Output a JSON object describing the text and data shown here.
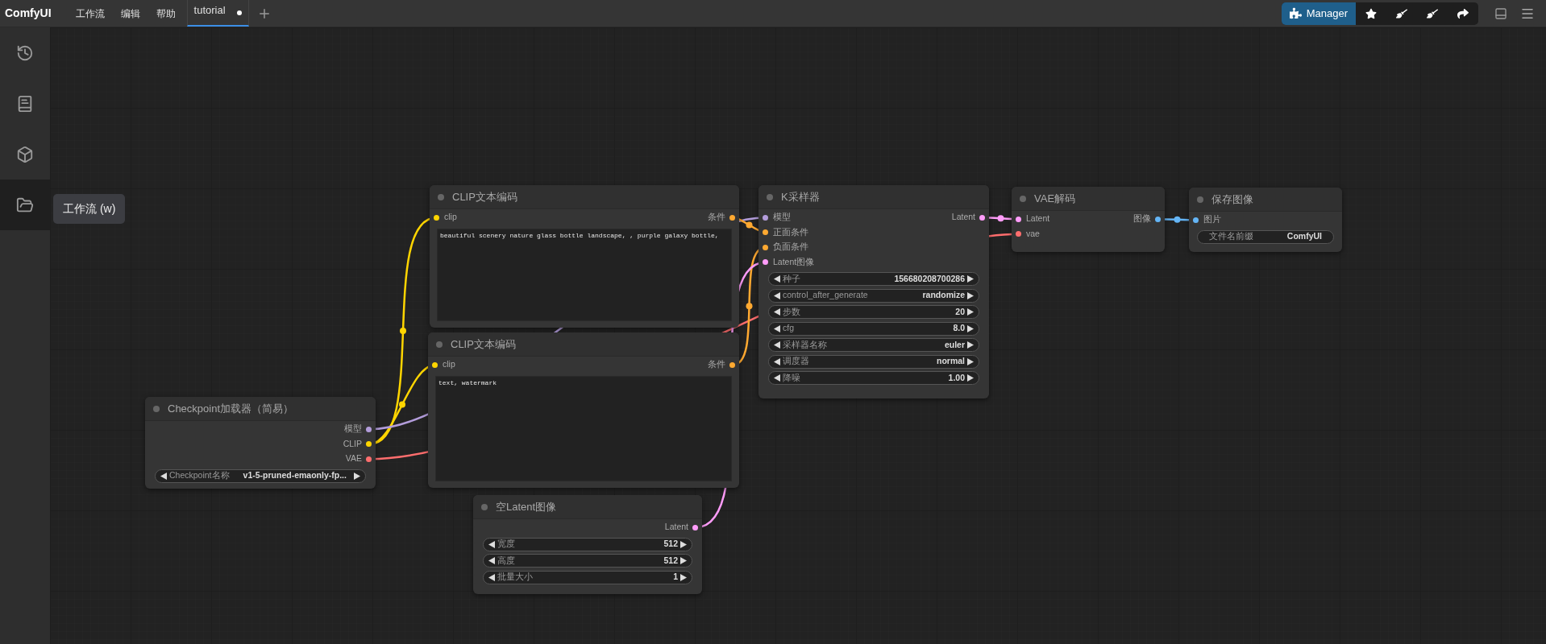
{
  "menu_bar": {
    "logo": "ComfyUI",
    "menus": [
      "工作流",
      "编辑",
      "帮助"
    ],
    "tabs": [
      {
        "label": "tutorial",
        "selected": true,
        "unsaved": true
      }
    ],
    "manager_button": "Manager"
  },
  "sidebar": {
    "items": [
      {
        "kind": "history",
        "selected": false
      },
      {
        "kind": "library",
        "selected": false
      },
      {
        "kind": "models",
        "selected": false
      },
      {
        "kind": "workflows",
        "selected": true
      }
    ],
    "tooltip": "工作流 (w)"
  },
  "nodes": [
    {
      "title": "CLIP文本编码",
      "inputs": [
        {
          "label": "clip",
          "color": "#ffd500"
        }
      ],
      "outputs": [
        {
          "label": "条件",
          "color": "#ffa931"
        }
      ],
      "widgets": [
        {
          "kind": "text",
          "value": "beautiful scenery nature glass bottle landscape, , purple galaxy bottle,"
        }
      ]
    },
    {
      "title": "K采样器",
      "inputs": [
        {
          "label": "模型",
          "color": "#b39ddb"
        },
        {
          "label": "正面条件",
          "color": "#ffa931"
        },
        {
          "label": "负面条件",
          "color": "#ffa931"
        },
        {
          "label": "Latent图像",
          "color": "#ff9cf9"
        }
      ],
      "outputs": [
        {
          "label": "Latent",
          "color": "#ff9cf9"
        }
      ],
      "widgets": [
        {
          "kind": "number",
          "label": "种子",
          "value": "156680208700286"
        },
        {
          "kind": "combo",
          "label": "control_after_generate",
          "value": "randomize"
        },
        {
          "kind": "number",
          "label": "步数",
          "value": "20"
        },
        {
          "kind": "number",
          "label": "cfg",
          "value": "8.0"
        },
        {
          "kind": "combo",
          "label": "采样器名称",
          "value": "euler"
        },
        {
          "kind": "combo",
          "label": "调度器",
          "value": "normal"
        },
        {
          "kind": "number",
          "label": "降噪",
          "value": "1.00"
        }
      ]
    },
    {
      "title": "VAE解码",
      "inputs": [
        {
          "label": "Latent",
          "color": "#ff9cf9"
        },
        {
          "label": "vae",
          "color": "#ff6e6e"
        }
      ],
      "outputs": [
        {
          "label": "图像",
          "color": "#64b5f6"
        }
      ]
    },
    {
      "title": "保存图像",
      "inputs": [
        {
          "label": "图片",
          "color": "#64b5f6"
        }
      ],
      "widgets": [
        {
          "kind": "string",
          "label": "文件名前缀",
          "value": "ComfyUI"
        }
      ]
    },
    {
      "title": "CLIP文本编码",
      "inputs": [
        {
          "label": "clip",
          "color": "#ffd500"
        }
      ],
      "outputs": [
        {
          "label": "条件",
          "color": "#ffa931"
        }
      ],
      "widgets": [
        {
          "kind": "text",
          "value": "text, watermark"
        }
      ]
    },
    {
      "title": "Checkpoint加载器（简易）",
      "outputs": [
        {
          "label": "模型",
          "color": "#b39ddb"
        },
        {
          "label": "CLIP",
          "color": "#ffd500"
        },
        {
          "label": "VAE",
          "color": "#ff6e6e"
        }
      ],
      "widgets": [
        {
          "kind": "combo",
          "label": "Checkpoint名称",
          "value": "v1-5-pruned-emaonly-fp..."
        }
      ]
    },
    {
      "title": "空Latent图像",
      "outputs": [
        {
          "label": "Latent",
          "color": "#ff9cf9"
        }
      ],
      "widgets": [
        {
          "kind": "number",
          "label": "宽度",
          "value": "512"
        },
        {
          "kind": "number",
          "label": "高度",
          "value": "512"
        },
        {
          "kind": "number",
          "label": "批量大小",
          "value": "1"
        }
      ]
    }
  ]
}
